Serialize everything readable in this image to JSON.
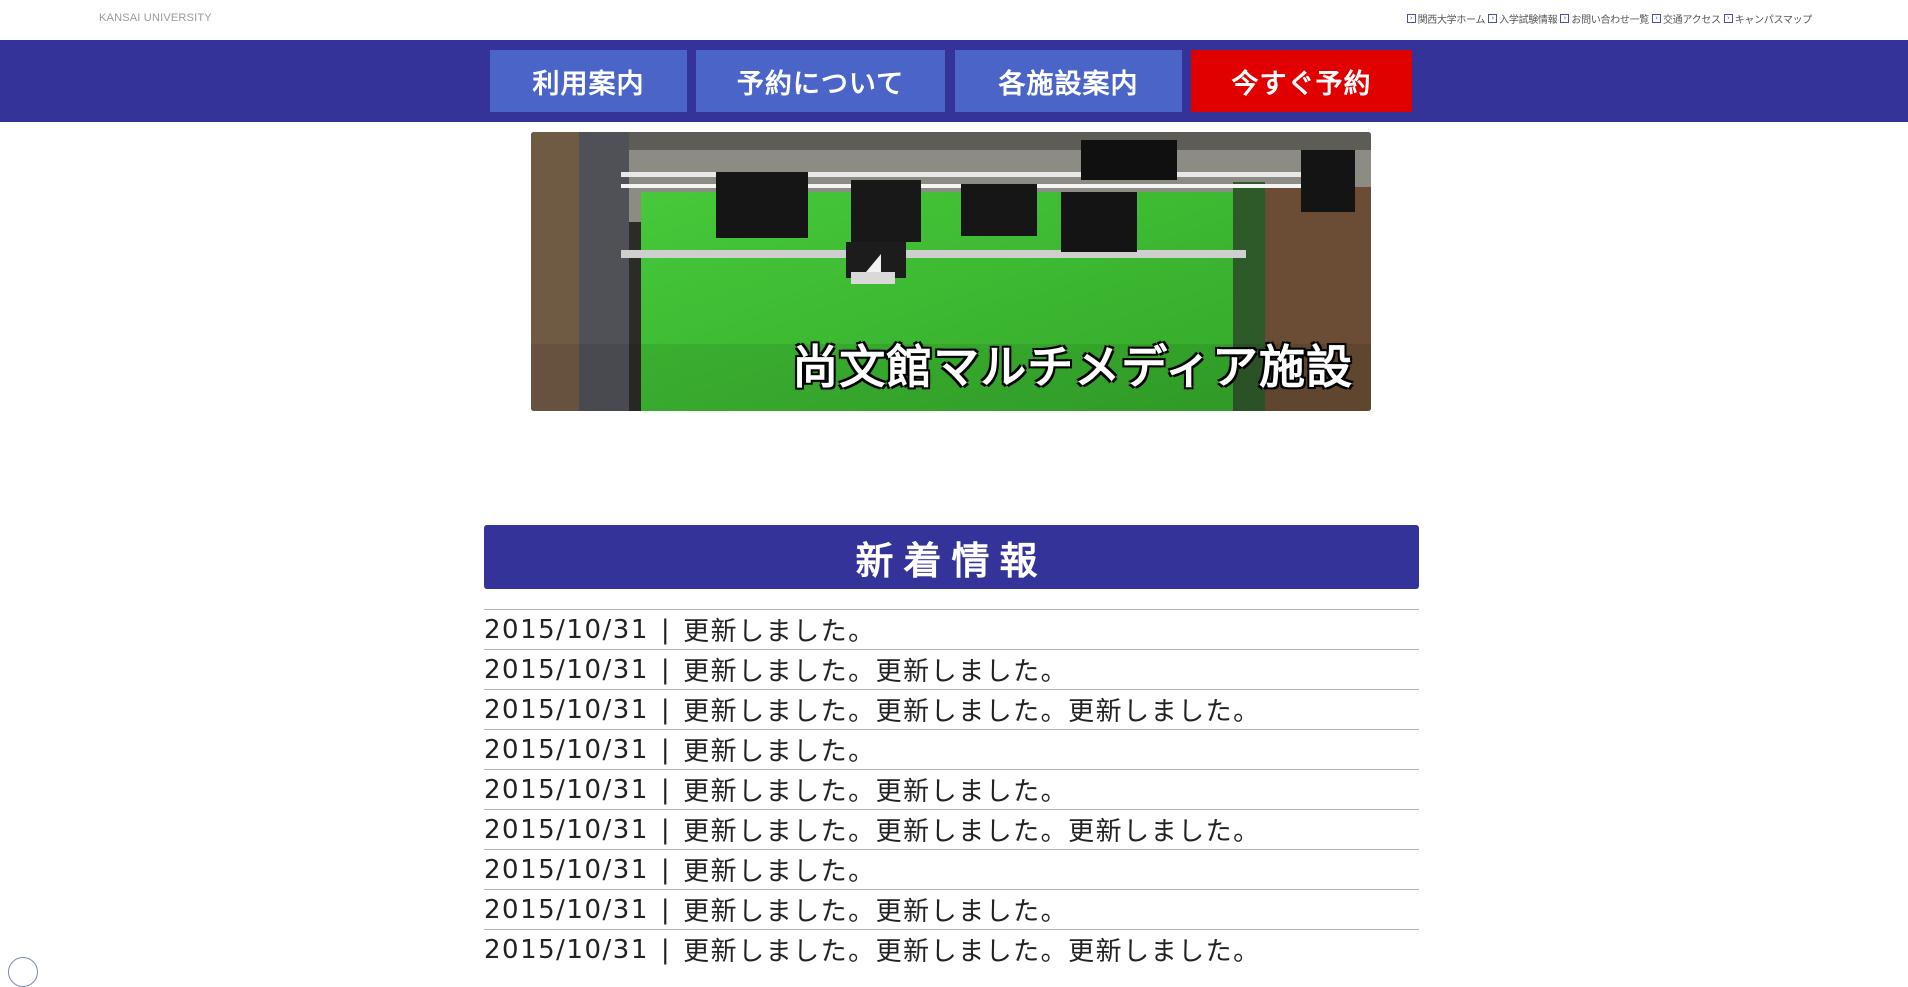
{
  "brand": "KANSAI UNIVERSITY",
  "top_links": [
    {
      "label": "関西大学ホーム",
      "icon": "external-link-icon"
    },
    {
      "label": "入学試験情報",
      "icon": "external-link-icon"
    },
    {
      "label": "お問い合わせ一覧",
      "icon": "external-link-icon"
    },
    {
      "label": "交通アクセス",
      "icon": "external-link-icon"
    },
    {
      "label": "キャンパスマップ",
      "icon": "external-link-icon"
    }
  ],
  "nav": [
    {
      "label": "利用案内"
    },
    {
      "label": "予約について"
    },
    {
      "label": "各施設案内"
    },
    {
      "label": "今すぐ予約"
    }
  ],
  "hero": {
    "caption": "尚文館マルチメディア施設"
  },
  "news": {
    "title": "新着情報",
    "items": [
      {
        "date": "2015/10/31",
        "text": "更新しました。"
      },
      {
        "date": "2015/10/31",
        "text": "更新しました。更新しました。"
      },
      {
        "date": "2015/10/31",
        "text": "更新しました。更新しました。更新しました。"
      },
      {
        "date": "2015/10/31",
        "text": "更新しました。"
      },
      {
        "date": "2015/10/31",
        "text": "更新しました。更新しました。"
      },
      {
        "date": "2015/10/31",
        "text": "更新しました。更新しました。更新しました。"
      },
      {
        "date": "2015/10/31",
        "text": "更新しました。"
      },
      {
        "date": "2015/10/31",
        "text": "更新しました。更新しました。"
      },
      {
        "date": "2015/10/31",
        "text": "更新しました。更新しました。更新しました。"
      }
    ],
    "separator": "|"
  },
  "colors": {
    "nav_bar": "#33339a",
    "nav_button": "#4a64c8",
    "cta_button": "#e00000",
    "greenscreen": "#3fc232"
  }
}
